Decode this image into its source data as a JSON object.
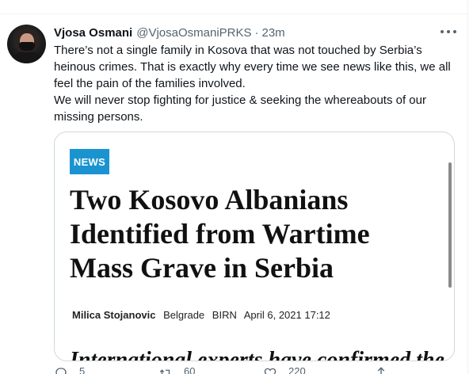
{
  "tweet": {
    "author_name": "Vjosa Osmani",
    "author_handle": "@VjosaOsmaniPRKS",
    "separator": "·",
    "timestamp": "23m",
    "text_lines": [
      "There’s not a single family in Kosova that was not touched by Serbia’s",
      "heinous crimes. That is exactly why every time we see news like this, we all",
      "feel the pain of the families involved.",
      "We will never stop fighting for justice & seeking the whereabouts of our",
      "missing persons."
    ]
  },
  "card": {
    "badge": "NEWS",
    "headline_lines": [
      "Two Kosovo Albanians",
      "Identified from Wartime",
      "Mass Grave in Serbia"
    ],
    "author": "Milica Stojanovic",
    "location": "Belgrade",
    "outlet": "BIRN",
    "date": "April 6, 2021 17:12",
    "body_preview": "International experts have confirmed the"
  },
  "actions": {
    "reply_count": "5",
    "retweet_count": "60",
    "like_count": "220"
  },
  "icons": {
    "more": "more-horizontal-icon",
    "reply": "reply-icon",
    "retweet": "retweet-icon",
    "like": "heart-icon",
    "share": "share-icon"
  },
  "colors": {
    "badge": "#1a94d0",
    "secondary_text": "#536471",
    "primary_text": "#0f1419"
  }
}
